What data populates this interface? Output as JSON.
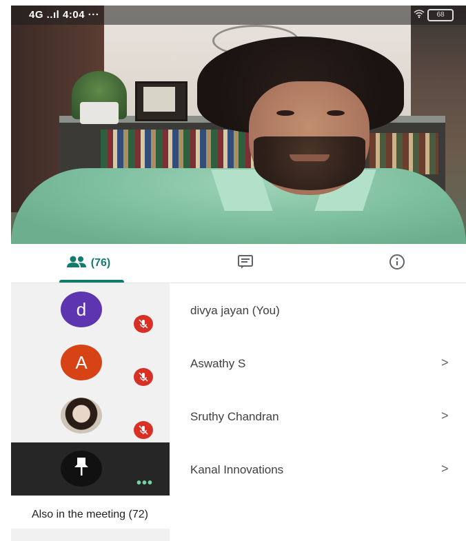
{
  "status_bar": {
    "signal": "4G ..ıl",
    "time": "4:04",
    "more": "···",
    "battery": "68"
  },
  "tabs": {
    "people_count": "(76)"
  },
  "participants": [
    {
      "initial": "d",
      "name": "divya jayan (You)",
      "avatar_color": "#5e35b1",
      "muted": true,
      "has_chevron": false
    },
    {
      "initial": "A",
      "name": "Aswathy S",
      "avatar_color": "#d84315",
      "muted": true,
      "has_chevron": true
    },
    {
      "initial": "",
      "name": "Sruthy Chandran",
      "avatar_color": "#c9b8a8",
      "muted": true,
      "has_chevron": true
    },
    {
      "initial": "",
      "name": "Kanal Innovations",
      "avatar_color": "#111111",
      "muted": false,
      "has_chevron": true
    }
  ],
  "section": {
    "title": "Also in the meeting (72)"
  },
  "chevron": ">",
  "colors": {
    "accent": "#137a6e",
    "mute_red": "#d93025",
    "speaking_green": "#6fd6a3"
  }
}
